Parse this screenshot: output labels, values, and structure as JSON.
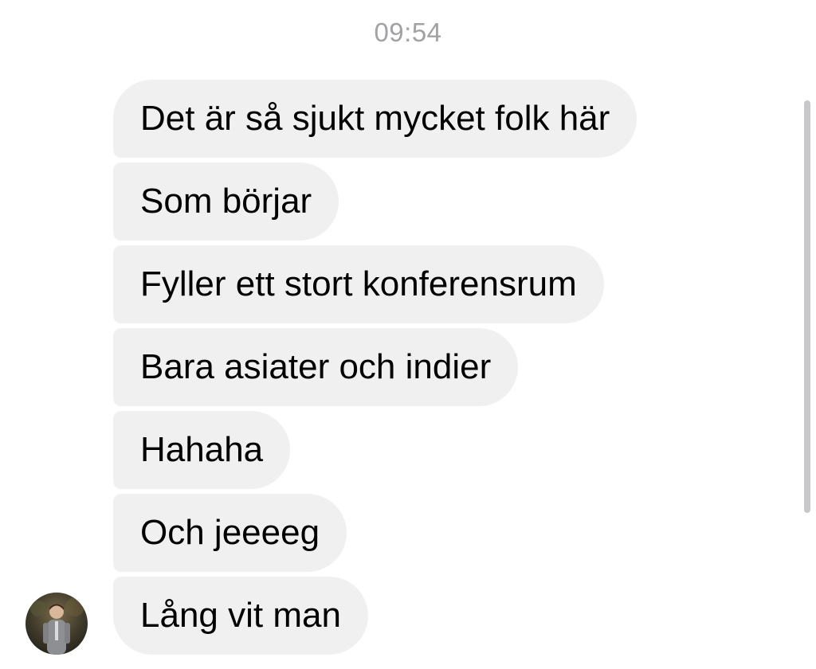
{
  "thread": {
    "timestamp": "09:54",
    "messages": [
      "Det är så sjukt mycket folk här",
      "Som börjar",
      "Fyller ett stort konferensrum",
      "Bara asiater och indier",
      "Hahaha",
      "Och jeeeeg",
      "Lång vit man"
    ]
  },
  "avatar": {
    "icon": "contact-photo"
  },
  "colors": {
    "bubble_background": "#f0f0f0",
    "timestamp": "#a2a2a6",
    "scrollbar": "#c8c8cc"
  }
}
